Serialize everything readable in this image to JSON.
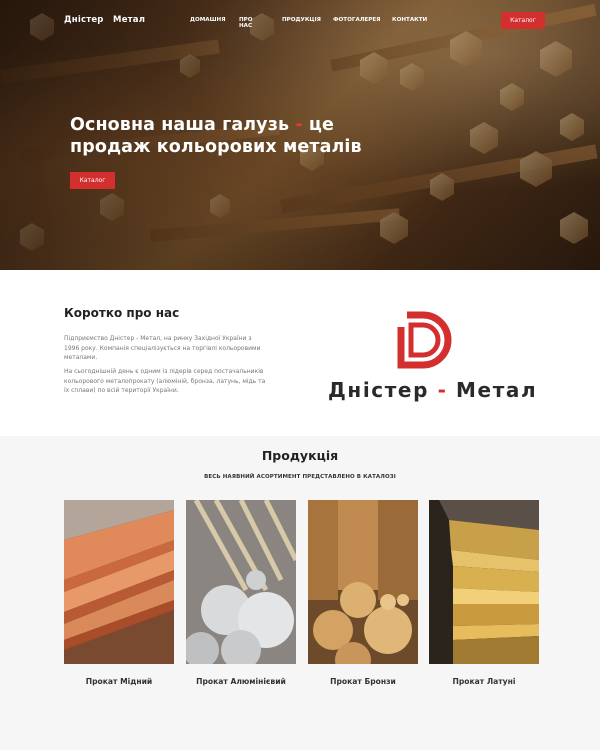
{
  "nav": {
    "brand": "Дністер   Метал",
    "items": [
      {
        "label": "ДОМАШНЯ"
      },
      {
        "label": "ПРО НАС"
      },
      {
        "label": "ПРОДУКЦІЯ"
      },
      {
        "label": "ФОТОГАЛЕРЕЯ"
      },
      {
        "label": "КОНТАКТИ"
      }
    ],
    "catalog_label": "Каталог"
  },
  "hero": {
    "title_part1": "Основна наша галузь ",
    "title_dash": "-",
    "title_part2": " це продаж кольорових металів",
    "catalog_label": "Каталог"
  },
  "about": {
    "title": "Коротко про нас",
    "p1": "Підприємство Дністер - Метал, на ринку Західної України з 1996 року. Компанія спеціалізується на торгівлі кольоровими металами.",
    "p2": "На сьогоднішній день є одним із лідерів серед постачальників кольорового металопрокату (алюміній, бронза, латунь, мідь та їх сплави) по всій території України.",
    "logo_left": "Дністер ",
    "logo_dash": "-",
    "logo_right": " Метал"
  },
  "products": {
    "title": "Продукція",
    "subtitle": "ВЕСЬ НАЯВНИЙ АСОРТИМЕНТ ПРЕДСТАВЛЕНО В КАТАЛОЗІ",
    "items": [
      {
        "label": "Прокат Мідний"
      },
      {
        "label": "Прокат Алюмінієвий"
      },
      {
        "label": "Прокат Бронзи"
      },
      {
        "label": "Прокат Латуні"
      }
    ]
  },
  "colors": {
    "accent": "#d32f2f",
    "text": "#222222",
    "muted": "#777777",
    "products_bg": "#f6f6f6"
  }
}
